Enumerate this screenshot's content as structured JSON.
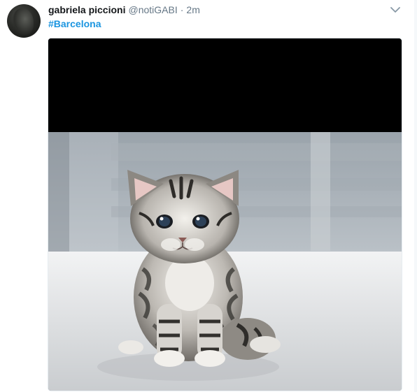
{
  "tweet": {
    "author": {
      "name": "gabriela piccioni",
      "handle": "@notiGABI",
      "avatar_icon": "user-avatar"
    },
    "separator": "·",
    "time": "2m",
    "text": {
      "hashtag": "#Barcelona"
    },
    "menu_icon": "chevron-down-icon",
    "media": {
      "kind": "photo",
      "subject": "tabby kitten"
    }
  },
  "colors": {
    "link": "#1b95e0",
    "secondary_text": "#657786",
    "primary_text": "#14171a",
    "border": "#e6ecf0"
  }
}
